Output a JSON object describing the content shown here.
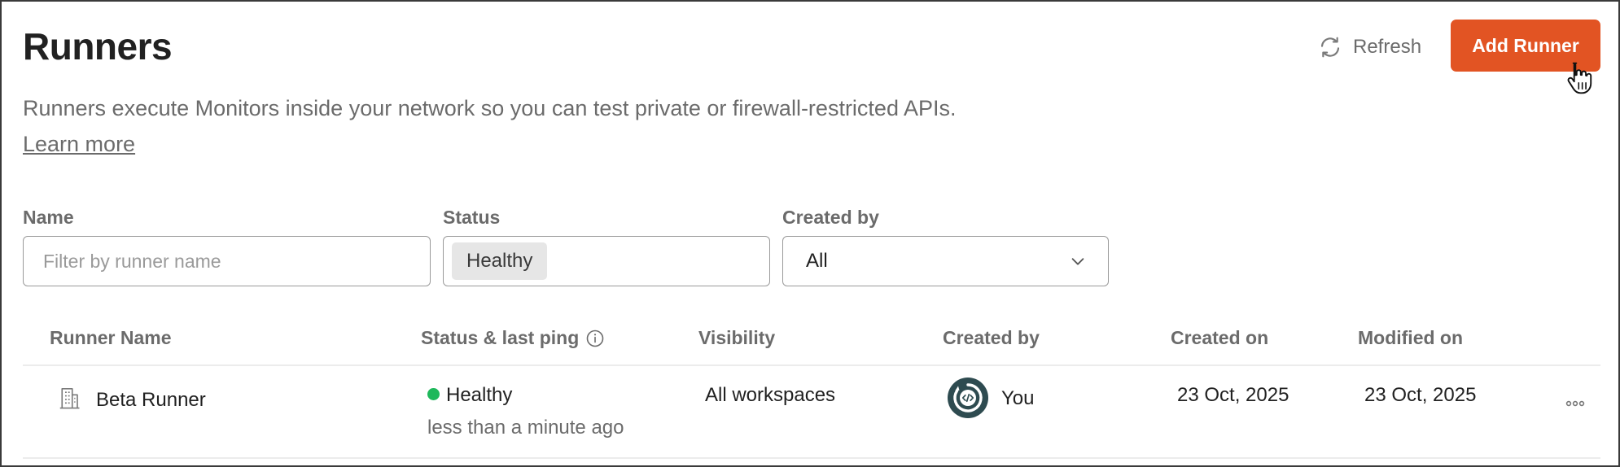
{
  "header": {
    "title": "Runners",
    "refresh_label": "Refresh",
    "add_button_label": "Add Runner"
  },
  "intro": {
    "description": "Runners execute Monitors inside your network so you can test private or firewall-restricted APIs.",
    "learn_more": "Learn more"
  },
  "filters": {
    "name": {
      "label": "Name",
      "placeholder": "Filter by runner name",
      "value": ""
    },
    "status": {
      "label": "Status",
      "selected_chip": "Healthy"
    },
    "created_by": {
      "label": "Created by",
      "value": "All"
    }
  },
  "table": {
    "columns": [
      "Runner Name",
      "Status & last ping",
      "Visibility",
      "Created by",
      "Created on",
      "Modified on"
    ],
    "rows": [
      {
        "name": "Beta Runner",
        "status": "Healthy",
        "last_ping": "less than a minute ago",
        "visibility": "All workspaces",
        "created_by": "You",
        "created_on": "23 Oct, 2025",
        "modified_on": "23 Oct, 2025"
      }
    ]
  },
  "colors": {
    "accent": "#e25423",
    "healthy": "#1fb85b",
    "avatar": "#2e4b50",
    "text_muted": "#6b6b6b",
    "border": "#9a9a9a"
  },
  "icons": {
    "refresh": "refresh-icon",
    "info": "info-icon",
    "building": "building-icon",
    "chevron": "chevron-down-icon",
    "more": "more-options-icon",
    "avatar": "code-avatar-icon",
    "cursor": "hand-pointer-cursor"
  }
}
